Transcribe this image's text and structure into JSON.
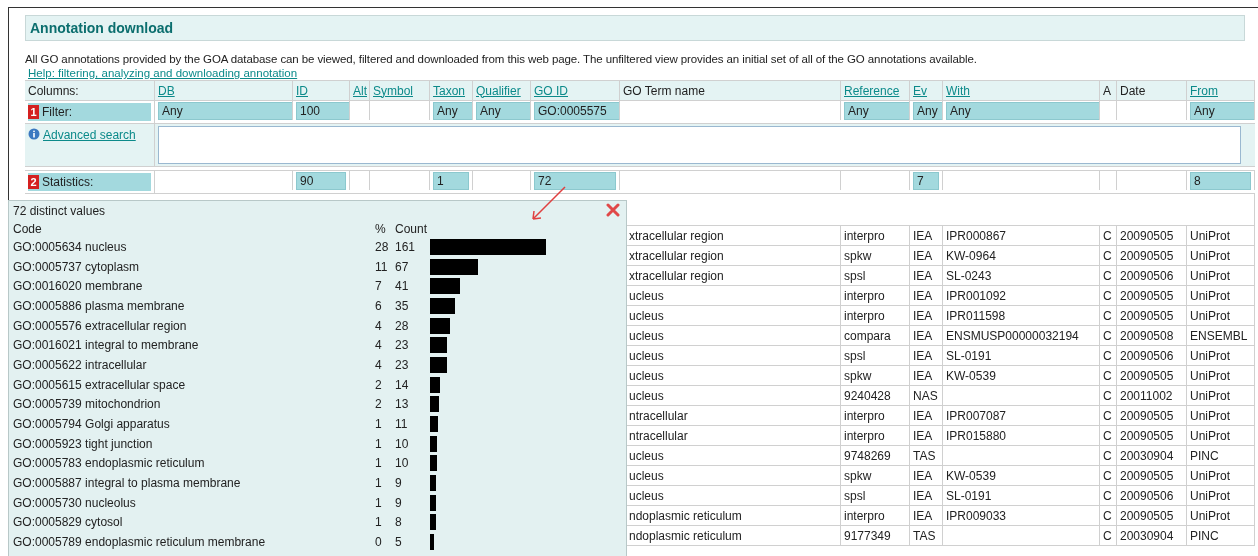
{
  "header": {
    "title": "Annotation download",
    "description": "All GO annotations provided by the GOA database can be viewed, filtered and downloaded from this web page. The unfiltered view provides an initial set of all of the GO annotations available.",
    "help_link": "Help: filtering, analyzing and downloading annotation"
  },
  "table": {
    "columns_label": "Columns:",
    "columns": [
      {
        "label": "DB",
        "kind": "link"
      },
      {
        "label": "ID",
        "kind": "link"
      },
      {
        "label": "Alt",
        "kind": "link"
      },
      {
        "label": "Symbol",
        "kind": "link"
      },
      {
        "label": "Taxon",
        "kind": "link"
      },
      {
        "label": "Qualifier",
        "kind": "link"
      },
      {
        "label": "GO ID",
        "kind": "link"
      },
      {
        "label": "GO Term name",
        "kind": "text"
      },
      {
        "label": "Reference",
        "kind": "link"
      },
      {
        "label": "Ev",
        "kind": "link"
      },
      {
        "label": "With",
        "kind": "link"
      },
      {
        "label": "A",
        "kind": "text"
      },
      {
        "label": "Date",
        "kind": "text"
      },
      {
        "label": "From",
        "kind": "link"
      }
    ],
    "filter": {
      "badge": "1",
      "label": "Filter:",
      "cells": [
        {
          "kind": "box",
          "value": "Any"
        },
        {
          "kind": "box",
          "value": "100"
        },
        {
          "kind": "empty"
        },
        {
          "kind": "empty"
        },
        {
          "kind": "box",
          "value": "Any"
        },
        {
          "kind": "box",
          "value": "Any"
        },
        {
          "kind": "box",
          "value": "GO:0005575"
        },
        {
          "kind": "empty"
        },
        {
          "kind": "box",
          "value": "Any"
        },
        {
          "kind": "box",
          "value": "Any"
        },
        {
          "kind": "box",
          "value": "Any"
        },
        {
          "kind": "empty"
        },
        {
          "kind": "empty"
        },
        {
          "kind": "box",
          "value": "Any"
        }
      ]
    },
    "advanced_search": "Advanced search",
    "statistics": {
      "badge": "2",
      "label": "Statistics:",
      "cells": [
        {
          "kind": "empty"
        },
        {
          "kind": "box",
          "value": "90"
        },
        {
          "kind": "empty"
        },
        {
          "kind": "empty"
        },
        {
          "kind": "box",
          "value": "1"
        },
        {
          "kind": "empty"
        },
        {
          "kind": "box",
          "value": "72"
        },
        {
          "kind": "empty"
        },
        {
          "kind": "empty"
        },
        {
          "kind": "box",
          "value": "7"
        },
        {
          "kind": "empty"
        },
        {
          "kind": "empty"
        },
        {
          "kind": "empty"
        },
        {
          "kind": "box",
          "value": "8"
        }
      ]
    },
    "rows": [
      {
        "term": "xtracellular region",
        "reference": "interpro",
        "evidence": "IEA",
        "with": "IPR000867",
        "aspect": "C",
        "date": "20090505",
        "source": "UniProt"
      },
      {
        "term": "xtracellular region",
        "reference": "spkw",
        "evidence": "IEA",
        "with": "KW-0964",
        "aspect": "C",
        "date": "20090505",
        "source": "UniProt"
      },
      {
        "term": "xtracellular region",
        "reference": "spsl",
        "evidence": "IEA",
        "with": "SL-0243",
        "aspect": "C",
        "date": "20090506",
        "source": "UniProt"
      },
      {
        "term": "ucleus",
        "reference": "interpro",
        "evidence": "IEA",
        "with": "IPR001092",
        "aspect": "C",
        "date": "20090505",
        "source": "UniProt"
      },
      {
        "term": "ucleus",
        "reference": "interpro",
        "evidence": "IEA",
        "with": "IPR011598",
        "aspect": "C",
        "date": "20090505",
        "source": "UniProt"
      },
      {
        "term": "ucleus",
        "reference": "compara",
        "evidence": "IEA",
        "with": "ENSMUSP00000032194",
        "aspect": "C",
        "date": "20090508",
        "source": "ENSEMBL"
      },
      {
        "term": "ucleus",
        "reference": "spsl",
        "evidence": "IEA",
        "with": "SL-0191",
        "aspect": "C",
        "date": "20090506",
        "source": "UniProt"
      },
      {
        "term": "ucleus",
        "reference": "spkw",
        "evidence": "IEA",
        "with": "KW-0539",
        "aspect": "C",
        "date": "20090505",
        "source": "UniProt"
      },
      {
        "term": "ucleus",
        "reference": "9240428",
        "evidence": "NAS",
        "aspect": "C",
        "date": "20011002",
        "source": "UniProt"
      },
      {
        "term": "ntracellular",
        "reference": "interpro",
        "evidence": "IEA",
        "with": "IPR007087",
        "aspect": "C",
        "date": "20090505",
        "source": "UniProt"
      },
      {
        "term": "ntracellular",
        "reference": "interpro",
        "evidence": "IEA",
        "with": "IPR015880",
        "aspect": "C",
        "date": "20090505",
        "source": "UniProt"
      },
      {
        "term": "ucleus",
        "reference": "9748269",
        "evidence": "TAS",
        "aspect": "C",
        "date": "20030904",
        "source": "PINC"
      },
      {
        "term": "ucleus",
        "reference": "spkw",
        "evidence": "IEA",
        "with": "KW-0539",
        "aspect": "C",
        "date": "20090505",
        "source": "UniProt"
      },
      {
        "term": "ucleus",
        "reference": "spsl",
        "evidence": "IEA",
        "with": "SL-0191",
        "aspect": "C",
        "date": "20090506",
        "source": "UniProt"
      },
      {
        "term": "ndoplasmic reticulum",
        "reference": "interpro",
        "evidence": "IEA",
        "with": "IPR009033",
        "aspect": "C",
        "date": "20090505",
        "source": "UniProt"
      },
      {
        "term": "ndoplasmic reticulum",
        "reference": "9177349",
        "evidence": "TAS",
        "aspect": "C",
        "date": "20030904",
        "source": "PINC"
      }
    ]
  },
  "popup": {
    "title": "72 distinct values",
    "code_header": "Code",
    "pct_header": "%",
    "count_header": "Count",
    "rows": [
      {
        "code": "GO:0005634 nucleus",
        "pct": "28",
        "count": "161"
      },
      {
        "code": "GO:0005737 cytoplasm",
        "pct": "11",
        "count": "67"
      },
      {
        "code": "GO:0016020 membrane",
        "pct": "7",
        "count": "41"
      },
      {
        "code": "GO:0005886 plasma membrane",
        "pct": "6",
        "count": "35"
      },
      {
        "code": "GO:0005576 extracellular region",
        "pct": "4",
        "count": "28"
      },
      {
        "code": "GO:0016021 integral to membrane",
        "pct": "4",
        "count": "23"
      },
      {
        "code": "GO:0005622 intracellular",
        "pct": "4",
        "count": "23"
      },
      {
        "code": "GO:0005615 extracellular space",
        "pct": "2",
        "count": "14"
      },
      {
        "code": "GO:0005739 mitochondrion",
        "pct": "2",
        "count": "13"
      },
      {
        "code": "GO:0005794 Golgi apparatus",
        "pct": "1",
        "count": "11"
      },
      {
        "code": "GO:0005923 tight junction",
        "pct": "1",
        "count": "10"
      },
      {
        "code": "GO:0005783 endoplasmic reticulum",
        "pct": "1",
        "count": "10"
      },
      {
        "code": "GO:0005887 integral to plasma membrane",
        "pct": "1",
        "count": "9"
      },
      {
        "code": "GO:0005730 nucleolus",
        "pct": "1",
        "count": "9"
      },
      {
        "code": "GO:0005829 cytosol",
        "pct": "1",
        "count": "8"
      },
      {
        "code": "GO:0005789 endoplasmic reticulum membrane",
        "pct": "0",
        "count": "5"
      }
    ]
  }
}
